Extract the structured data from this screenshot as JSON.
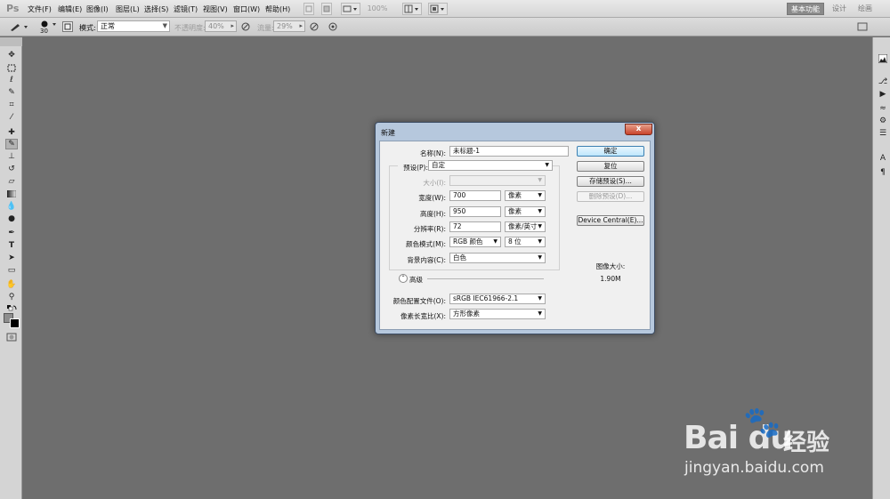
{
  "app": {
    "logo": "Ps"
  },
  "menu": [
    "文件(F)",
    "编辑(E)",
    "图像(I)",
    "图层(L)",
    "选择(S)",
    "滤镜(T)",
    "视图(V)",
    "窗口(W)",
    "帮助(H)"
  ],
  "appbar": {
    "zoom": "100%"
  },
  "workspaces": {
    "essentials": "基本功能",
    "design": "设计",
    "painting": "绘画"
  },
  "options": {
    "brush_size": "30",
    "mode_label": "模式:",
    "mode_value": "正常",
    "opacity_label": "不透明度:",
    "opacity_value": "40%",
    "flow_label": "流量:",
    "flow_value": "29%"
  },
  "dialog": {
    "title": "新建",
    "close_label": "x",
    "fields": {
      "name_label": "名称(N):",
      "name_value": "未标题-1",
      "preset_label": "预设(P):",
      "preset_value": "自定",
      "size_label": "大小(I):",
      "size_value": "",
      "width_label": "宽度(W):",
      "width_value": "700",
      "width_unit": "像素",
      "height_label": "高度(H):",
      "height_value": "950",
      "height_unit": "像素",
      "resolution_label": "分辨率(R):",
      "resolution_value": "72",
      "resolution_unit": "像素/英寸",
      "color_mode_label": "颜色模式(M):",
      "color_mode_value": "RGB 颜色",
      "bit_depth": "8 位",
      "background_label": "背景内容(C):",
      "background_value": "白色",
      "advanced_label": "高级",
      "color_profile_label": "颜色配置文件(O):",
      "color_profile_value": "sRGB IEC61966-2.1",
      "pixel_aspect_label": "像素长宽比(X):",
      "pixel_aspect_value": "方形像素"
    },
    "buttons": {
      "ok": "确定",
      "reset": "复位",
      "save_preset": "存储预设(S)...",
      "delete_preset": "删除预设(D)...",
      "device_central": "Device Central(E)..."
    },
    "image_size_label": "图像大小:",
    "image_size_value": "1.90M"
  },
  "watermark": {
    "logo": "Bai  du",
    "brand": "经验",
    "url": "jingyan.baidu.com"
  }
}
